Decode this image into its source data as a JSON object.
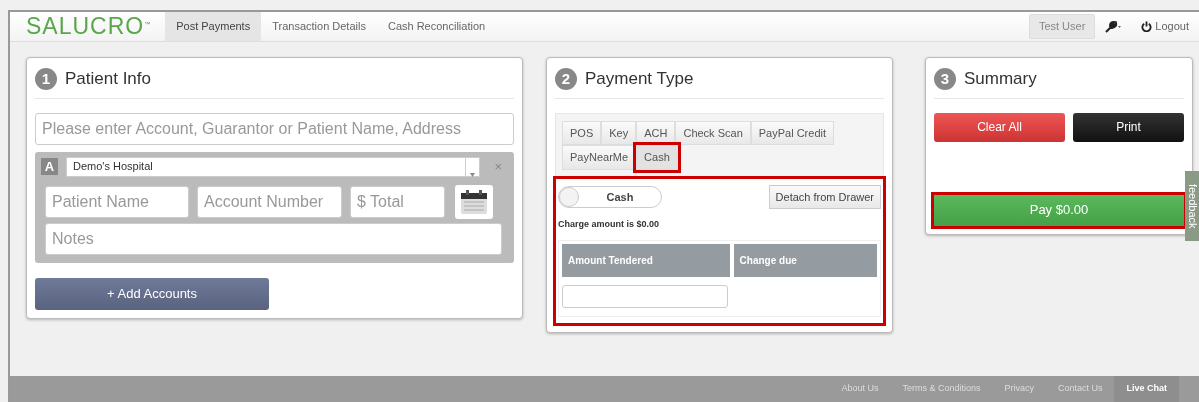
{
  "navbar": {
    "logo": "SALUCRO",
    "logo_mark": "™",
    "nav": [
      {
        "label": "Post Payments",
        "selected": true
      },
      {
        "label": "Transaction Details",
        "selected": false
      },
      {
        "label": "Cash Reconciliation",
        "selected": false
      }
    ],
    "user": "Test User",
    "logout": "Logout"
  },
  "patient_info": {
    "step": "1",
    "title": "Patient Info",
    "search": {
      "placeholder": "Please enter Account, Guarantor or Patient Name, Address"
    },
    "account": {
      "letter": "A",
      "facility": "Demo's Hospital",
      "close": "×",
      "patient_name": {
        "placeholder": "Patient Name"
      },
      "account_number": {
        "placeholder": "Account Number"
      },
      "total": {
        "placeholder": "$ Total"
      },
      "notes": {
        "placeholder": "Notes"
      }
    },
    "add_button": "+ Add Accounts"
  },
  "payment_type": {
    "step": "2",
    "title": "Payment Type",
    "tabs": [
      {
        "label": "POS",
        "selected": false,
        "highlighted": false
      },
      {
        "label": "Key",
        "selected": false,
        "highlighted": false
      },
      {
        "label": "ACH",
        "selected": false,
        "highlighted": false
      },
      {
        "label": "Check Scan",
        "selected": false,
        "highlighted": false
      },
      {
        "label": "PayPal Credit",
        "selected": false,
        "highlighted": false
      },
      {
        "label": "PayNearMe",
        "selected": false,
        "highlighted": false
      },
      {
        "label": "Cash",
        "selected": true,
        "highlighted": true
      }
    ],
    "panel": {
      "highlighted": true,
      "toggle": {
        "label": "Cash",
        "on": false
      },
      "detach_button": "Detach from Drawer",
      "charge_text": "Charge amount is $0.00",
      "columns": [
        "Amount Tendered",
        "Change due"
      ]
    }
  },
  "summary": {
    "step": "3",
    "title": "Summary",
    "clear_button": "Clear All",
    "print_button": "Print",
    "pay_button": {
      "label": "Pay $0.00",
      "highlighted": true
    }
  },
  "feedback_tab": "feedback",
  "footer": {
    "links": [
      {
        "label": "About Us",
        "selected": false
      },
      {
        "label": "Terms & Conditions",
        "selected": false
      },
      {
        "label": "Privacy",
        "selected": false
      },
      {
        "label": "Contact Us",
        "selected": false
      },
      {
        "label": "Live Chat",
        "selected": true
      }
    ]
  }
}
